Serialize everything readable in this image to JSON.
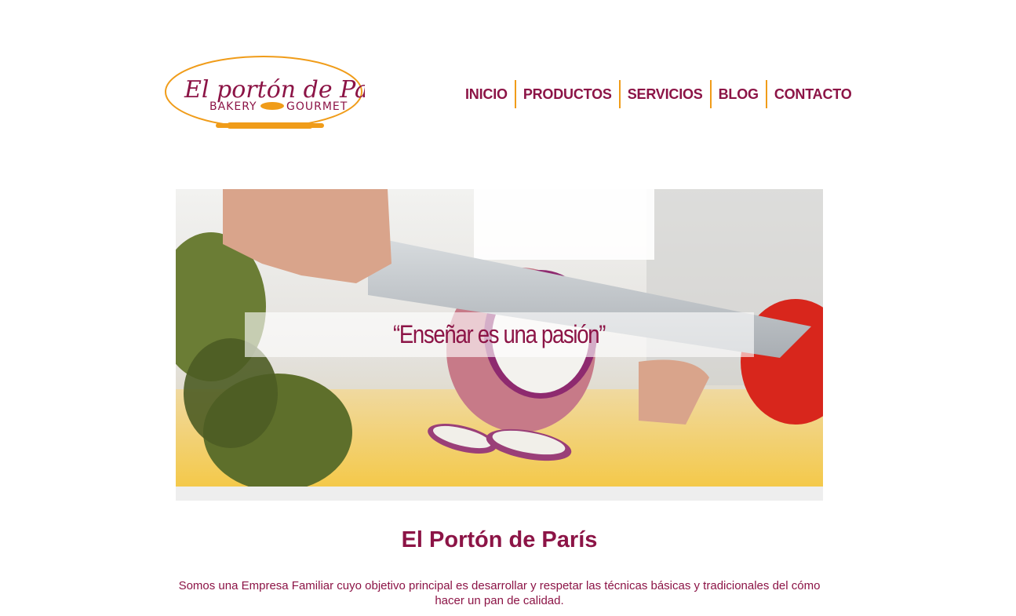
{
  "logo": {
    "script_text": "El portón de París",
    "tagline_left": "BAKERY",
    "tagline_right": "GOURMET",
    "colors": {
      "primary": "#8c1446",
      "accent": "#f09c19"
    }
  },
  "nav": {
    "items": [
      {
        "label": "INICIO"
      },
      {
        "label": "PRODUCTOS"
      },
      {
        "label": "SERVICIOS"
      },
      {
        "label": "BLOG"
      },
      {
        "label": "CONTACTO"
      }
    ]
  },
  "hero": {
    "caption": "“Enseñar es una pasión”"
  },
  "main": {
    "title": "El Portón de París",
    "description": "Somos una Empresa Familiar cuyo objetivo principal es desarrollar y respetar las técnicas básicas y tradicionales del cómo hacer un pan de calidad."
  },
  "theme": {
    "primary": "#8c1446",
    "accent": "#f09c19",
    "background": "#ffffff"
  }
}
